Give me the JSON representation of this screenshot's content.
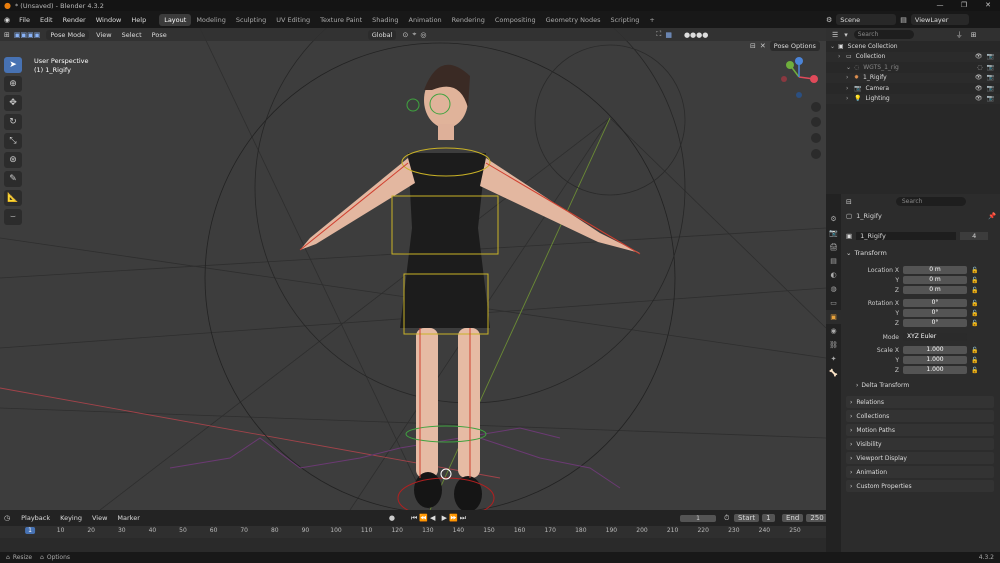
{
  "window": {
    "title": "* (Unsaved) - Blender 4.3.2",
    "controls": [
      "—",
      "❐",
      "✕"
    ]
  },
  "menu": {
    "items": [
      "File",
      "Edit",
      "Render",
      "Window",
      "Help"
    ]
  },
  "workspaces": [
    "Layout",
    "Modeling",
    "Sculpting",
    "UV Editing",
    "Texture Paint",
    "Shading",
    "Animation",
    "Rendering",
    "Compositing",
    "Geometry Nodes",
    "Scripting"
  ],
  "active_workspace": "Layout",
  "scene": "Scene",
  "view_layer": "ViewLayer",
  "viewport": {
    "mode": "Pose Mode",
    "menus": [
      "View",
      "Select",
      "Pose"
    ],
    "orientation": "Global",
    "pose_options": "Pose Options",
    "info_line1": "User Perspective",
    "info_line2": "(1) 1_Rigify"
  },
  "outliner": {
    "search_placeholder": "Search",
    "rows": [
      {
        "label": "Scene Collection",
        "indent": 0
      },
      {
        "label": "Collection",
        "indent": 1
      },
      {
        "label": "WGTS_1_rig",
        "indent": 2
      },
      {
        "label": "1_Rigify",
        "indent": 2
      },
      {
        "label": "Camera",
        "indent": 2
      },
      {
        "label": "Lighting",
        "indent": 2
      }
    ]
  },
  "properties": {
    "search_placeholder": "Search",
    "object_name": "1_Rigify",
    "data_name": "1_Rigify",
    "users": "4",
    "transform_label": "Transform",
    "location": {
      "label": "Location X",
      "x": "0 m",
      "y": "0 m",
      "z": "0 m"
    },
    "rotation": {
      "label": "Rotation X",
      "x": "0°",
      "y": "0°",
      "z": "0°"
    },
    "mode": {
      "label": "Mode",
      "value": "XYZ Euler"
    },
    "scale": {
      "label": "Scale X",
      "x": "1.000",
      "y": "1.000",
      "z": "1.000"
    },
    "axis_y": "Y",
    "axis_z": "Z",
    "delta_transform": "Delta Transform",
    "panels": [
      "Relations",
      "Collections",
      "Motion Paths",
      "Visibility",
      "Viewport Display",
      "Animation",
      "Custom Properties"
    ]
  },
  "timeline": {
    "menus": [
      "Playback",
      "Keying",
      "View",
      "Marker"
    ],
    "current_frame": "1",
    "start_label": "Start",
    "start": "1",
    "end_label": "End",
    "end": "250",
    "ruler": [
      "1",
      "10",
      "20",
      "30",
      "40",
      "50",
      "60",
      "70",
      "80",
      "90",
      "100",
      "110",
      "120",
      "130",
      "140",
      "150",
      "160",
      "170",
      "180",
      "190",
      "200",
      "210",
      "220",
      "230",
      "240",
      "250"
    ]
  },
  "status": {
    "left1": "Resize",
    "left2": "Options",
    "version": "4.3.2"
  }
}
